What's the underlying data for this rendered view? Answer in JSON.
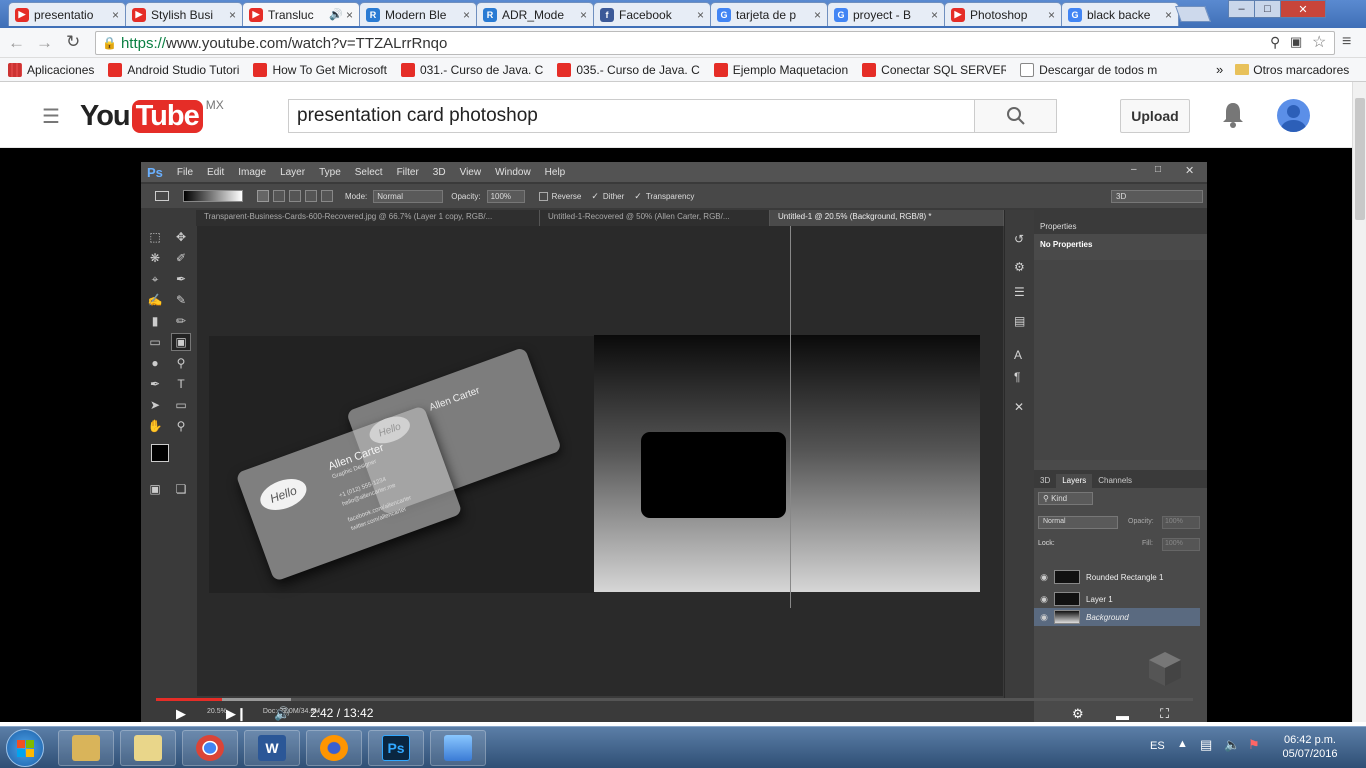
{
  "browser": {
    "tabs": [
      {
        "label": "presentatio",
        "icon": "youtube-icon",
        "active": false
      },
      {
        "label": "Stylish Busi",
        "icon": "youtube-icon",
        "active": false
      },
      {
        "label": "Transluc",
        "icon": "youtube-icon",
        "active": true
      },
      {
        "label": "Modern Ble",
        "icon": "site-icon",
        "active": false
      },
      {
        "label": "ADR_Mode",
        "icon": "site-icon",
        "active": false
      },
      {
        "label": "Facebook",
        "icon": "facebook-icon",
        "active": false
      },
      {
        "label": "tarjeta de p",
        "icon": "google-icon",
        "active": false
      },
      {
        "label": "proyect - B",
        "icon": "google-icon",
        "active": false
      },
      {
        "label": "Photoshop",
        "icon": "youtube-icon",
        "active": false
      },
      {
        "label": "black backe",
        "icon": "google-icon",
        "active": false
      }
    ],
    "url_scheme": "https://",
    "url_rest": "www.youtube.com/watch?v=TTZALrrRnqo",
    "bookmarks": [
      {
        "label": "Aplicaciones",
        "icon": "apps-icon"
      },
      {
        "label": "Android Studio Tutori",
        "icon": "youtube-icon"
      },
      {
        "label": "How To Get Microsoft",
        "icon": "youtube-icon"
      },
      {
        "label": "031.- Curso de Java. C",
        "icon": "youtube-icon"
      },
      {
        "label": "035.- Curso de Java. C",
        "icon": "youtube-icon"
      },
      {
        "label": "Ejemplo Maquetacion",
        "icon": "youtube-icon"
      },
      {
        "label": "Conectar SQL SERVER",
        "icon": "youtube-icon"
      },
      {
        "label": "Descargar de todos m",
        "icon": "page-icon"
      }
    ],
    "bookmarks_more": "»",
    "other_bookmarks": "Otros marcadores"
  },
  "youtube": {
    "logo_you": "You",
    "logo_tube": "Tube",
    "region": "MX",
    "search_value": "presentation card photoshop",
    "upload_label": "Upload"
  },
  "photoshop": {
    "logo": "Ps",
    "menu": [
      "File",
      "Edit",
      "Image",
      "Layer",
      "Type",
      "Select",
      "Filter",
      "3D",
      "View",
      "Window",
      "Help"
    ],
    "options": {
      "mode_label": "Mode:",
      "mode_value": "Normal",
      "opacity_label": "Opacity:",
      "opacity_value": "100%",
      "reverse": "Reverse",
      "dither": "Dither",
      "transparency": "Transparency",
      "workspace": "3D"
    },
    "doc_tabs": [
      "Transparent-Business-Cards-600-Recovered.jpg @ 66.7% (Layer 1 copy, RGB/...",
      "Untitled-1-Recovered @ 50% (Allen Carter, RGB/...",
      "Untitled-1 @ 20.5% (Background, RGB/8) *"
    ],
    "properties_tab": "Properties",
    "properties_body": "No Properties",
    "layer_tabs": [
      "3D",
      "Layers",
      "Channels"
    ],
    "kind_label": "Kind",
    "blend_mode": "Normal",
    "opacity_label": "Opacity:",
    "opacity_value": "100%",
    "lock_label": "Lock:",
    "fill_label": "Fill:",
    "fill_value": "100%",
    "layers": [
      {
        "name": "Rounded Rectangle 1",
        "selected": false
      },
      {
        "name": "Layer 1",
        "selected": false
      },
      {
        "name": "Background",
        "selected": true
      }
    ],
    "card": {
      "hello": "Hello",
      "name": "Allen Carter",
      "role": "Graphic Designer",
      "lines": [
        "+1 (012) 555-1234",
        "hello@allencarter.me",
        "facebook.com/allencarter",
        "twitter.com/allencarter"
      ]
    },
    "zoom": "20.5%",
    "doc_info": "Doc: 22.0M/34.3M"
  },
  "video": {
    "progress_fraction": 0.064,
    "buffered_fraction": 0.13,
    "time": "2:42 / 13:42"
  },
  "taskbar": {
    "apps": [
      "explorer-icon",
      "folder-icon",
      "chrome-icon",
      "word-icon",
      "firefox-icon",
      "photoshop-icon",
      "photos-icon"
    ],
    "language": "ES",
    "time": "06:42 p.m.",
    "date": "05/07/2016"
  }
}
